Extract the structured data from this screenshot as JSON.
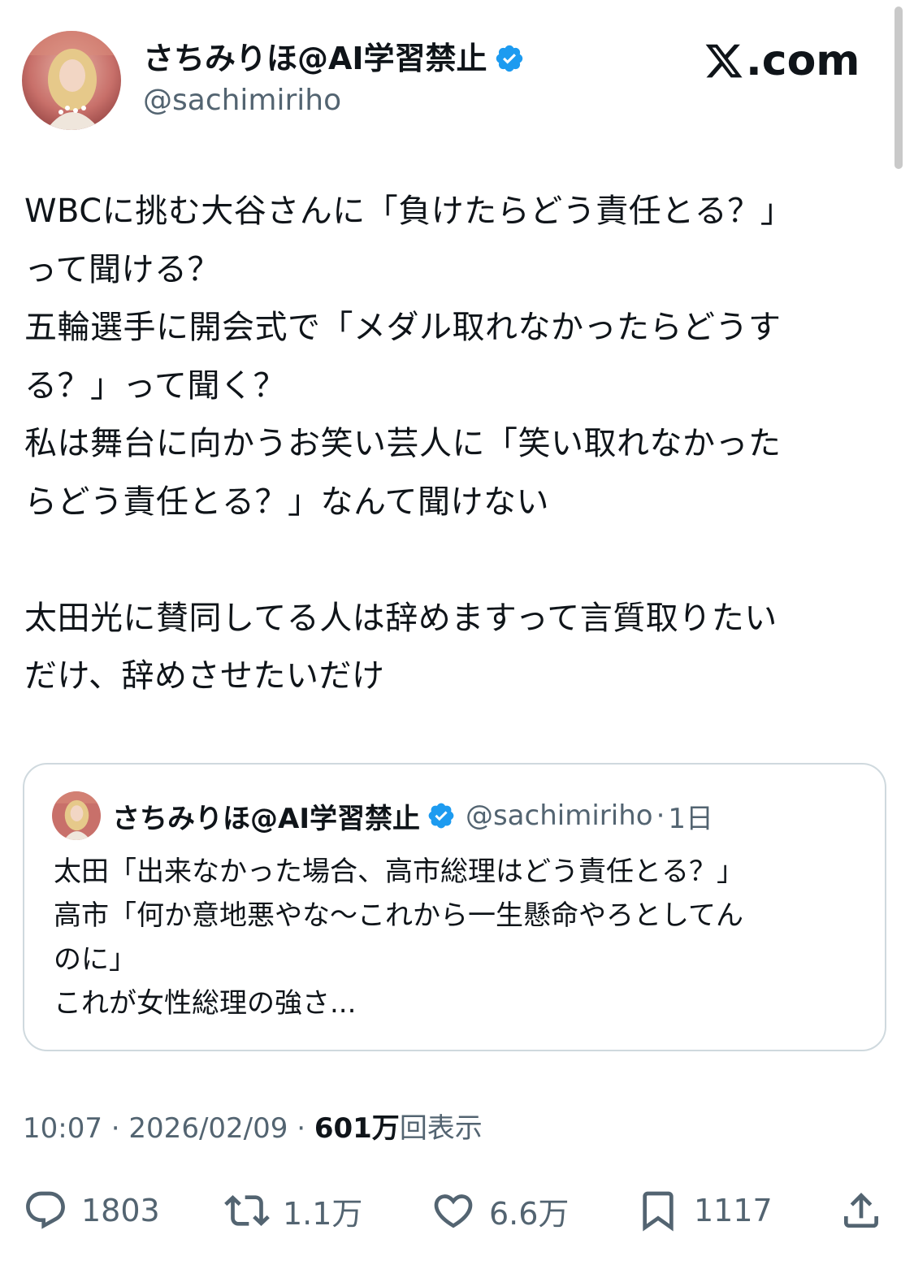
{
  "author": {
    "display_name": "さちみりほ@AI学習禁止",
    "handle": "@sachimiriho",
    "verified": true
  },
  "brand": {
    "text": ".com",
    "icon": "x-logo-icon"
  },
  "tweet": {
    "lines": [
      "WBCに挑む大谷さんに「負けたらどう責任とる？」",
      "って聞ける？",
      "五輪選手に開会式で「メダル取れなかったらどうす",
      "る？」って聞く？",
      "私は舞台に向かうお笑い芸人に「笑い取れなかった",
      "らどう責任とる？」なんて聞けない",
      "",
      "太田光に賛同してる人は辞めますって言質取りたい",
      "だけ、辞めさせたいだけ"
    ]
  },
  "quoted_tweet": {
    "display_name": "さちみりほ@AI学習禁止",
    "handle": "@sachimiriho",
    "separator": "·",
    "time": "1日",
    "lines": [
      "太田「出来なかった場合、高市総理はどう責任とる？」",
      "高市「何か意地悪やな〜これから一生懸命やろとしてん",
      "のに」",
      "これが女性総理の強さ..."
    ]
  },
  "meta": {
    "time": "10:07",
    "sep1": " · ",
    "date": "2026/02/09",
    "sep2": " · ",
    "views_count": "601万",
    "views_label": "回表示"
  },
  "actions": {
    "replies": "1803",
    "retweets": "1.1万",
    "likes": "6.6万",
    "bookmarks": "1117"
  },
  "colors": {
    "text": "#0f1419",
    "secondary": "#536471",
    "verified": "#1d9bf0",
    "border": "#cfd9de"
  }
}
